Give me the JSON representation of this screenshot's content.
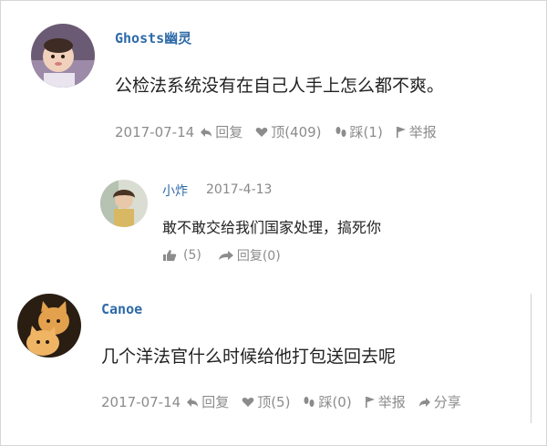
{
  "comments": [
    {
      "username": "Ghosts幽灵",
      "text": "公检法系统没有在自己人手上怎么都不爽。",
      "date": "2017-07-14",
      "reply_label": "回复",
      "like_label": "顶(409)",
      "dislike_label": "踩(1)",
      "report_label": "举报",
      "replies": [
        {
          "username": "小炸",
          "date": "2017-4-13",
          "text": "敢不敢交给我们国家处理，搞死你",
          "like_count": "(5)",
          "reply_label": "回复(0)"
        }
      ]
    },
    {
      "username": "Canoe",
      "text": "几个洋法官什么时候给他打包送回去呢",
      "date": "2017-07-14",
      "reply_label": "回复",
      "like_label": "顶(5)",
      "dislike_label": "踩(0)",
      "report_label": "举报",
      "share_label": "分享"
    }
  ],
  "colors": {
    "username": "#2e6aa8",
    "meta": "#8c8c8c",
    "text": "#222222"
  }
}
